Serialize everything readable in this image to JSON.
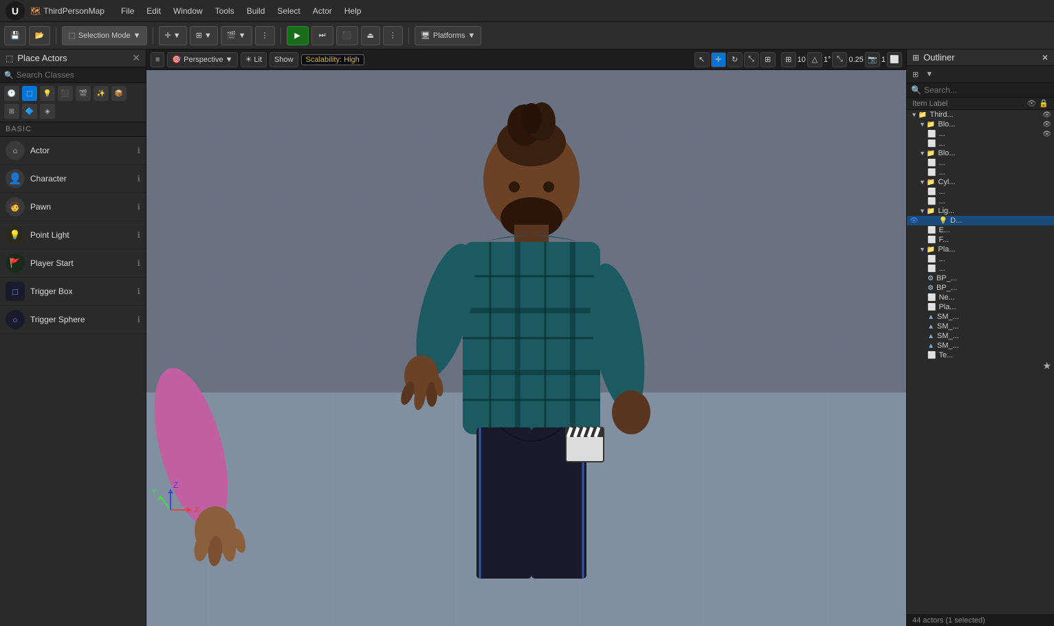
{
  "titlebar": {
    "logo": "U",
    "map_name": "ThirdPersonMap",
    "menus": [
      "File",
      "Edit",
      "Window",
      "Tools",
      "Build",
      "Select",
      "Actor",
      "Help"
    ]
  },
  "toolbar": {
    "save_btn": "💾",
    "content_btn": "📁",
    "selection_mode": "Selection Mode",
    "add_btn": "+",
    "play_btn": "▶",
    "pause_btn": "⏸",
    "stop_btn": "⬛",
    "platforms_btn": "Platforms"
  },
  "place_actors": {
    "title": "Place Actors",
    "search_placeholder": "Search Classes",
    "basic_label": "BASIC",
    "actors": [
      {
        "name": "Actor",
        "icon": "○"
      },
      {
        "name": "Character",
        "icon": "👤"
      },
      {
        "name": "Pawn",
        "icon": "🧑"
      },
      {
        "name": "Point Light",
        "icon": "💡"
      },
      {
        "name": "Player Start",
        "icon": "🚩"
      },
      {
        "name": "Trigger Box",
        "icon": "□"
      },
      {
        "name": "Trigger Sphere",
        "icon": "○"
      }
    ]
  },
  "viewport": {
    "perspective_label": "Perspective",
    "lit_label": "Lit",
    "show_label": "Show",
    "scalability_label": "Scalability: High",
    "grid_size": "10",
    "angle": "1°",
    "scale": "0.25",
    "camera": "1"
  },
  "outliner": {
    "title": "Outliner",
    "search_placeholder": "Search...",
    "item_label": "Item Label",
    "items": [
      {
        "name": "Third...",
        "type": "folder",
        "depth": 0
      },
      {
        "name": "Blo...",
        "type": "folder",
        "depth": 1
      },
      {
        "name": "...",
        "type": "mesh",
        "depth": 2
      },
      {
        "name": "...",
        "type": "mesh",
        "depth": 2
      },
      {
        "name": "Blo...",
        "type": "folder",
        "depth": 1
      },
      {
        "name": "...",
        "type": "mesh",
        "depth": 2
      },
      {
        "name": "...",
        "type": "mesh",
        "depth": 2
      },
      {
        "name": "Cyl...",
        "type": "folder",
        "depth": 1
      },
      {
        "name": "...",
        "type": "mesh",
        "depth": 2
      },
      {
        "name": "...",
        "type": "mesh",
        "depth": 2
      },
      {
        "name": "Lig...",
        "type": "folder",
        "depth": 1
      },
      {
        "name": "D...",
        "type": "light",
        "depth": 2,
        "selected": true
      },
      {
        "name": "E...",
        "type": "item",
        "depth": 2
      },
      {
        "name": "F...",
        "type": "item",
        "depth": 2
      },
      {
        "name": "Pla...",
        "type": "folder",
        "depth": 1
      },
      {
        "name": "...",
        "type": "mesh",
        "depth": 2
      },
      {
        "name": "...",
        "type": "mesh",
        "depth": 2
      },
      {
        "name": "BP_...",
        "type": "blueprint",
        "depth": 2
      },
      {
        "name": "BP_...",
        "type": "blueprint",
        "depth": 2
      },
      {
        "name": "Ne...",
        "type": "item",
        "depth": 2
      },
      {
        "name": "Pla...",
        "type": "item",
        "depth": 2
      },
      {
        "name": "SM_...",
        "type": "static_mesh",
        "depth": 2
      },
      {
        "name": "SM_...",
        "type": "static_mesh",
        "depth": 2
      },
      {
        "name": "SM_...",
        "type": "static_mesh",
        "depth": 2
      },
      {
        "name": "SM_...",
        "type": "static_mesh",
        "depth": 2
      },
      {
        "name": "Te...",
        "type": "item",
        "depth": 2
      }
    ]
  },
  "status_bar": {
    "text": "44 actors (1 selected)"
  },
  "icons": {
    "search": "🔍",
    "close": "✕",
    "eye": "👁",
    "lock": "🔒",
    "folder": "📁",
    "star": "★",
    "filter": "⊞",
    "settings": "⚙",
    "chevron_down": "▼",
    "hamburger": "≡",
    "move": "✛",
    "rotate": "↻",
    "scale_icon": "⤡",
    "world": "🌐",
    "camera_icon": "📷"
  }
}
